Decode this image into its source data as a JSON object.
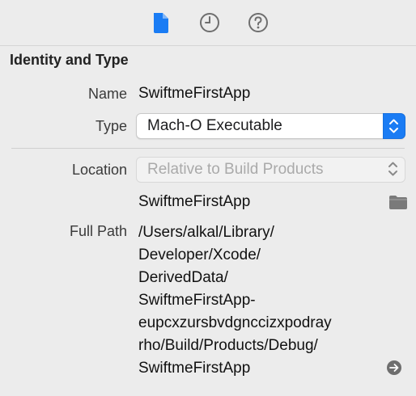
{
  "tabs": [
    {
      "name": "file-inspector",
      "icon": "document-icon",
      "active": true
    },
    {
      "name": "history-inspector",
      "icon": "clock-icon",
      "active": false
    },
    {
      "name": "quick-help-inspector",
      "icon": "question-icon",
      "active": false
    }
  ],
  "section": {
    "title": "Identity and Type"
  },
  "identity": {
    "name_label": "Name",
    "name_value": "SwiftmeFirstApp",
    "type_label": "Type",
    "type_value": "Mach-O Executable"
  },
  "location": {
    "label": "Location",
    "value": "Relative to Build Products",
    "file_name": "SwiftmeFirstApp",
    "full_path_label": "Full Path",
    "full_path_lines": [
      "/Users/alkal/Library/",
      "Developer/Xcode/",
      "DerivedData/",
      "SwiftmeFirstApp-",
      "eupcxzursbvdgnccizxpodray",
      "rho/Build/Products/Debug/",
      "SwiftmeFirstApp"
    ]
  },
  "colors": {
    "accent": "#1a7cf4",
    "icon_gray": "#6e6e6e"
  }
}
